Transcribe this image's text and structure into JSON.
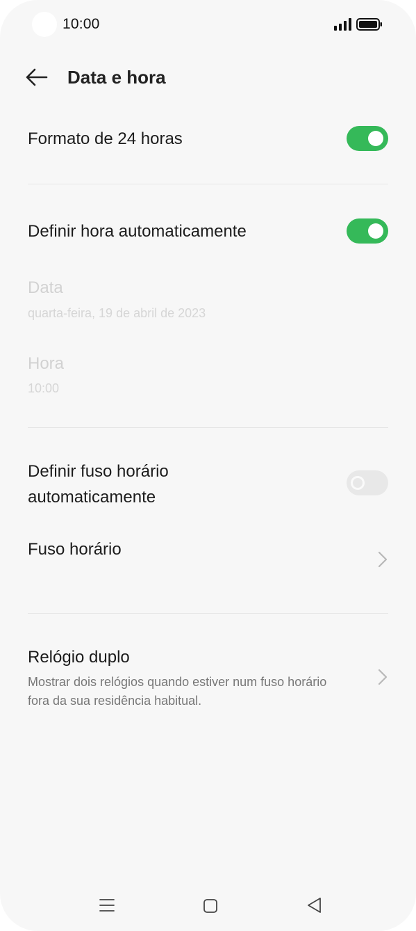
{
  "status_bar": {
    "time": "10:00",
    "signal_icon": "signal-icon",
    "battery_icon": "battery-icon"
  },
  "header": {
    "title": "Data e hora",
    "back_icon": "arrow-left-icon"
  },
  "settings": {
    "format_24h": {
      "label": "Formato de 24 horas",
      "enabled": true
    },
    "auto_time": {
      "label": "Definir hora automaticamente",
      "enabled": true
    },
    "date": {
      "label": "Data",
      "value": "quarta-feira, 19 de abril de 2023"
    },
    "time": {
      "label": "Hora",
      "value": "10:00"
    },
    "auto_timezone": {
      "label_line1": "Definir fuso horário",
      "label_line2": "automaticamente",
      "enabled": false
    },
    "timezone": {
      "label": "Fuso horário"
    },
    "dual_clock": {
      "label": "Relógio duplo",
      "desc_line1": "Mostrar dois relógios quando estiver num fuso horário",
      "desc_line2": "fora da sua residência habitual."
    }
  },
  "nav_bar": {
    "menu_icon": "menu-icon",
    "home_icon": "home-icon",
    "back_icon": "back-triangle-icon"
  },
  "colors": {
    "toggle_on": "#35b959",
    "toggle_off": "#e8e8e8",
    "background": "#f7f7f7"
  }
}
